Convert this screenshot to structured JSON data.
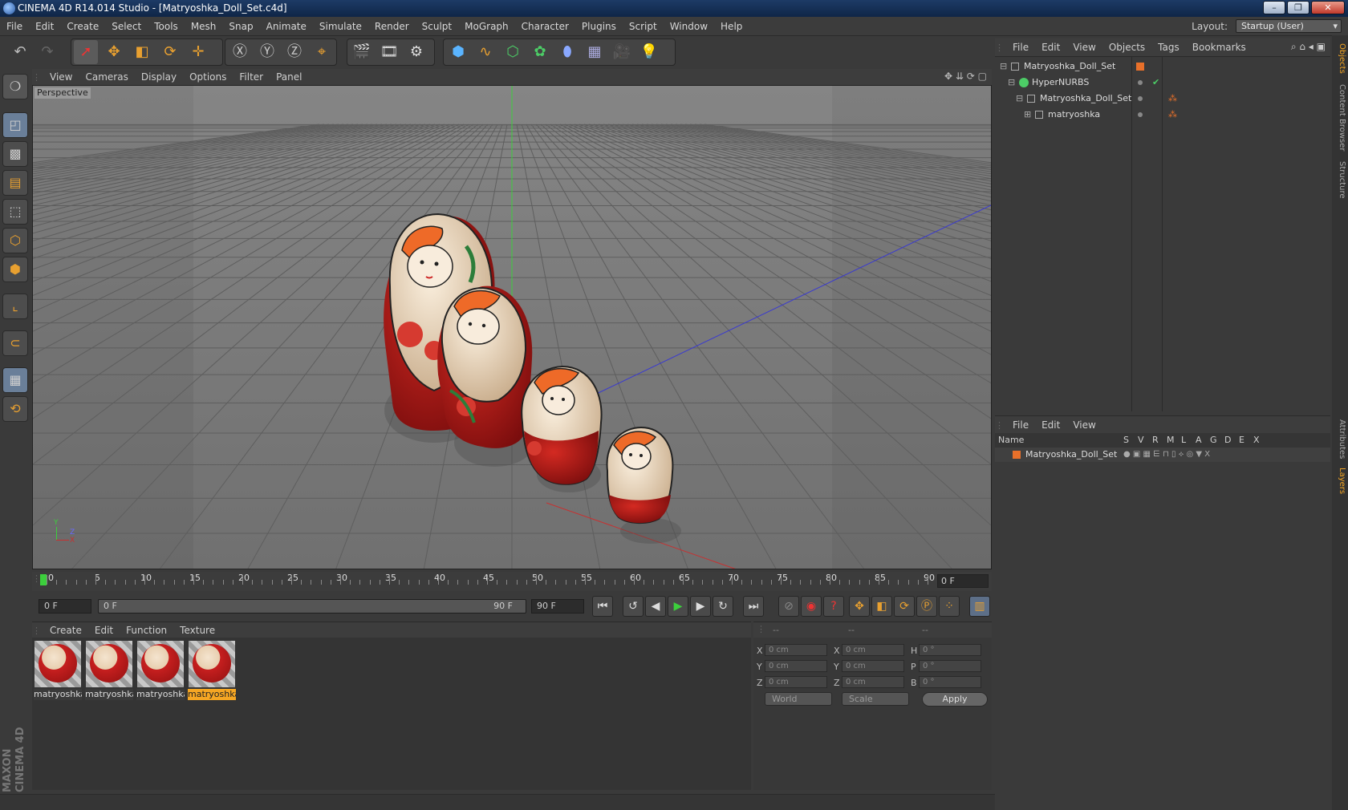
{
  "title": "CINEMA 4D R14.014 Studio - [Matryoshka_Doll_Set.c4d]",
  "menubar": {
    "items": [
      "File",
      "Edit",
      "Create",
      "Select",
      "Tools",
      "Mesh",
      "Snap",
      "Animate",
      "Simulate",
      "Render",
      "Sculpt",
      "MoGraph",
      "Character",
      "Plugins",
      "Script",
      "Window",
      "Help"
    ],
    "layout_label": "Layout:",
    "layout_value": "Startup (User)"
  },
  "viewport": {
    "menu": [
      "View",
      "Cameras",
      "Display",
      "Options",
      "Filter",
      "Panel"
    ],
    "label": "Perspective",
    "axis": {
      "y": "Y",
      "z": "Z",
      "x": "X"
    }
  },
  "timeline": {
    "ticks": [
      "0",
      "5",
      "10",
      "15",
      "20",
      "25",
      "30",
      "35",
      "40",
      "45",
      "50",
      "55",
      "60",
      "65",
      "70",
      "75",
      "80",
      "85",
      "90"
    ],
    "current": "0 F"
  },
  "transport": {
    "start": "0 F",
    "range_start": "0 F",
    "range_end": "90 F",
    "end": "90 F"
  },
  "materials": {
    "menu": [
      "Create",
      "Edit",
      "Function",
      "Texture"
    ],
    "items": [
      {
        "label": "matryoshka",
        "selected": false
      },
      {
        "label": "matryoshka",
        "selected": false
      },
      {
        "label": "matryoshka",
        "selected": false
      },
      {
        "label": "matryoshka",
        "selected": true
      }
    ]
  },
  "coordinates": {
    "headers": [
      "--",
      "--",
      "--"
    ],
    "rows": [
      {
        "a": "X",
        "av": "0 cm",
        "b": "X",
        "bv": "0 cm",
        "c": "H",
        "cv": "0 °"
      },
      {
        "a": "Y",
        "av": "0 cm",
        "b": "Y",
        "bv": "0 cm",
        "c": "P",
        "cv": "0 °"
      },
      {
        "a": "Z",
        "av": "0 cm",
        "b": "Z",
        "bv": "0 cm",
        "c": "B",
        "cv": "0 °"
      }
    ],
    "mode1": "World",
    "mode2": "Scale",
    "apply": "Apply"
  },
  "objects": {
    "menu": [
      "File",
      "Edit",
      "View",
      "Objects",
      "Tags",
      "Bookmarks"
    ],
    "tree": [
      "Matryoshka_Doll_Set",
      "HyperNURBS",
      "Matryoshka_Doll_Set",
      "matryoshka"
    ]
  },
  "layers": {
    "menu": [
      "File",
      "Edit",
      "View"
    ],
    "columns": [
      "Name",
      "S",
      "V",
      "R",
      "M",
      "L",
      "A",
      "G",
      "D",
      "E",
      "X"
    ],
    "row": "Matryoshka_Doll_Set"
  },
  "sidetabs": [
    "Objects",
    "Content Browser",
    "Structure",
    "Attributes",
    "Layers"
  ],
  "brand": "MAXON CINEMA 4D",
  "colors": {
    "accent": "#f5a623",
    "doll_red": "#c61f1f",
    "doll_cream": "#efdcc2"
  }
}
